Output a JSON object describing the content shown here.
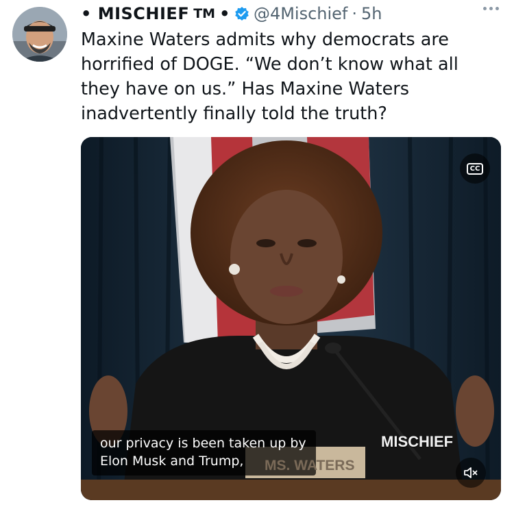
{
  "tweet": {
    "author_name": "• MISCHIEF",
    "author_tm": "TM",
    "author_suffix": "•",
    "handle": "@4Mischief",
    "separator": "·",
    "time": "5h",
    "text": "Maxine Waters admits why democrats are\nhorrified of DOGE. “We don’t know what all\nthey have on us.” Has Maxine Waters\ninadvertently finally told the truth?"
  },
  "video": {
    "caption": "our privacy is been taken up by\nElon Musk and Trump,",
    "watermark": "MISCHIEF",
    "nameplate": "MS. WATERS",
    "cc_label": "CC"
  },
  "icons": {
    "avatar": "avatar",
    "verified": "verified-badge-icon",
    "more": "more-options-icon",
    "captions": "closed-captions-icon",
    "mute": "muted-speaker-icon"
  },
  "colors": {
    "verified_blue": "#1d9bf0",
    "secondary_text": "#536471",
    "primary_text": "#0f1419"
  }
}
